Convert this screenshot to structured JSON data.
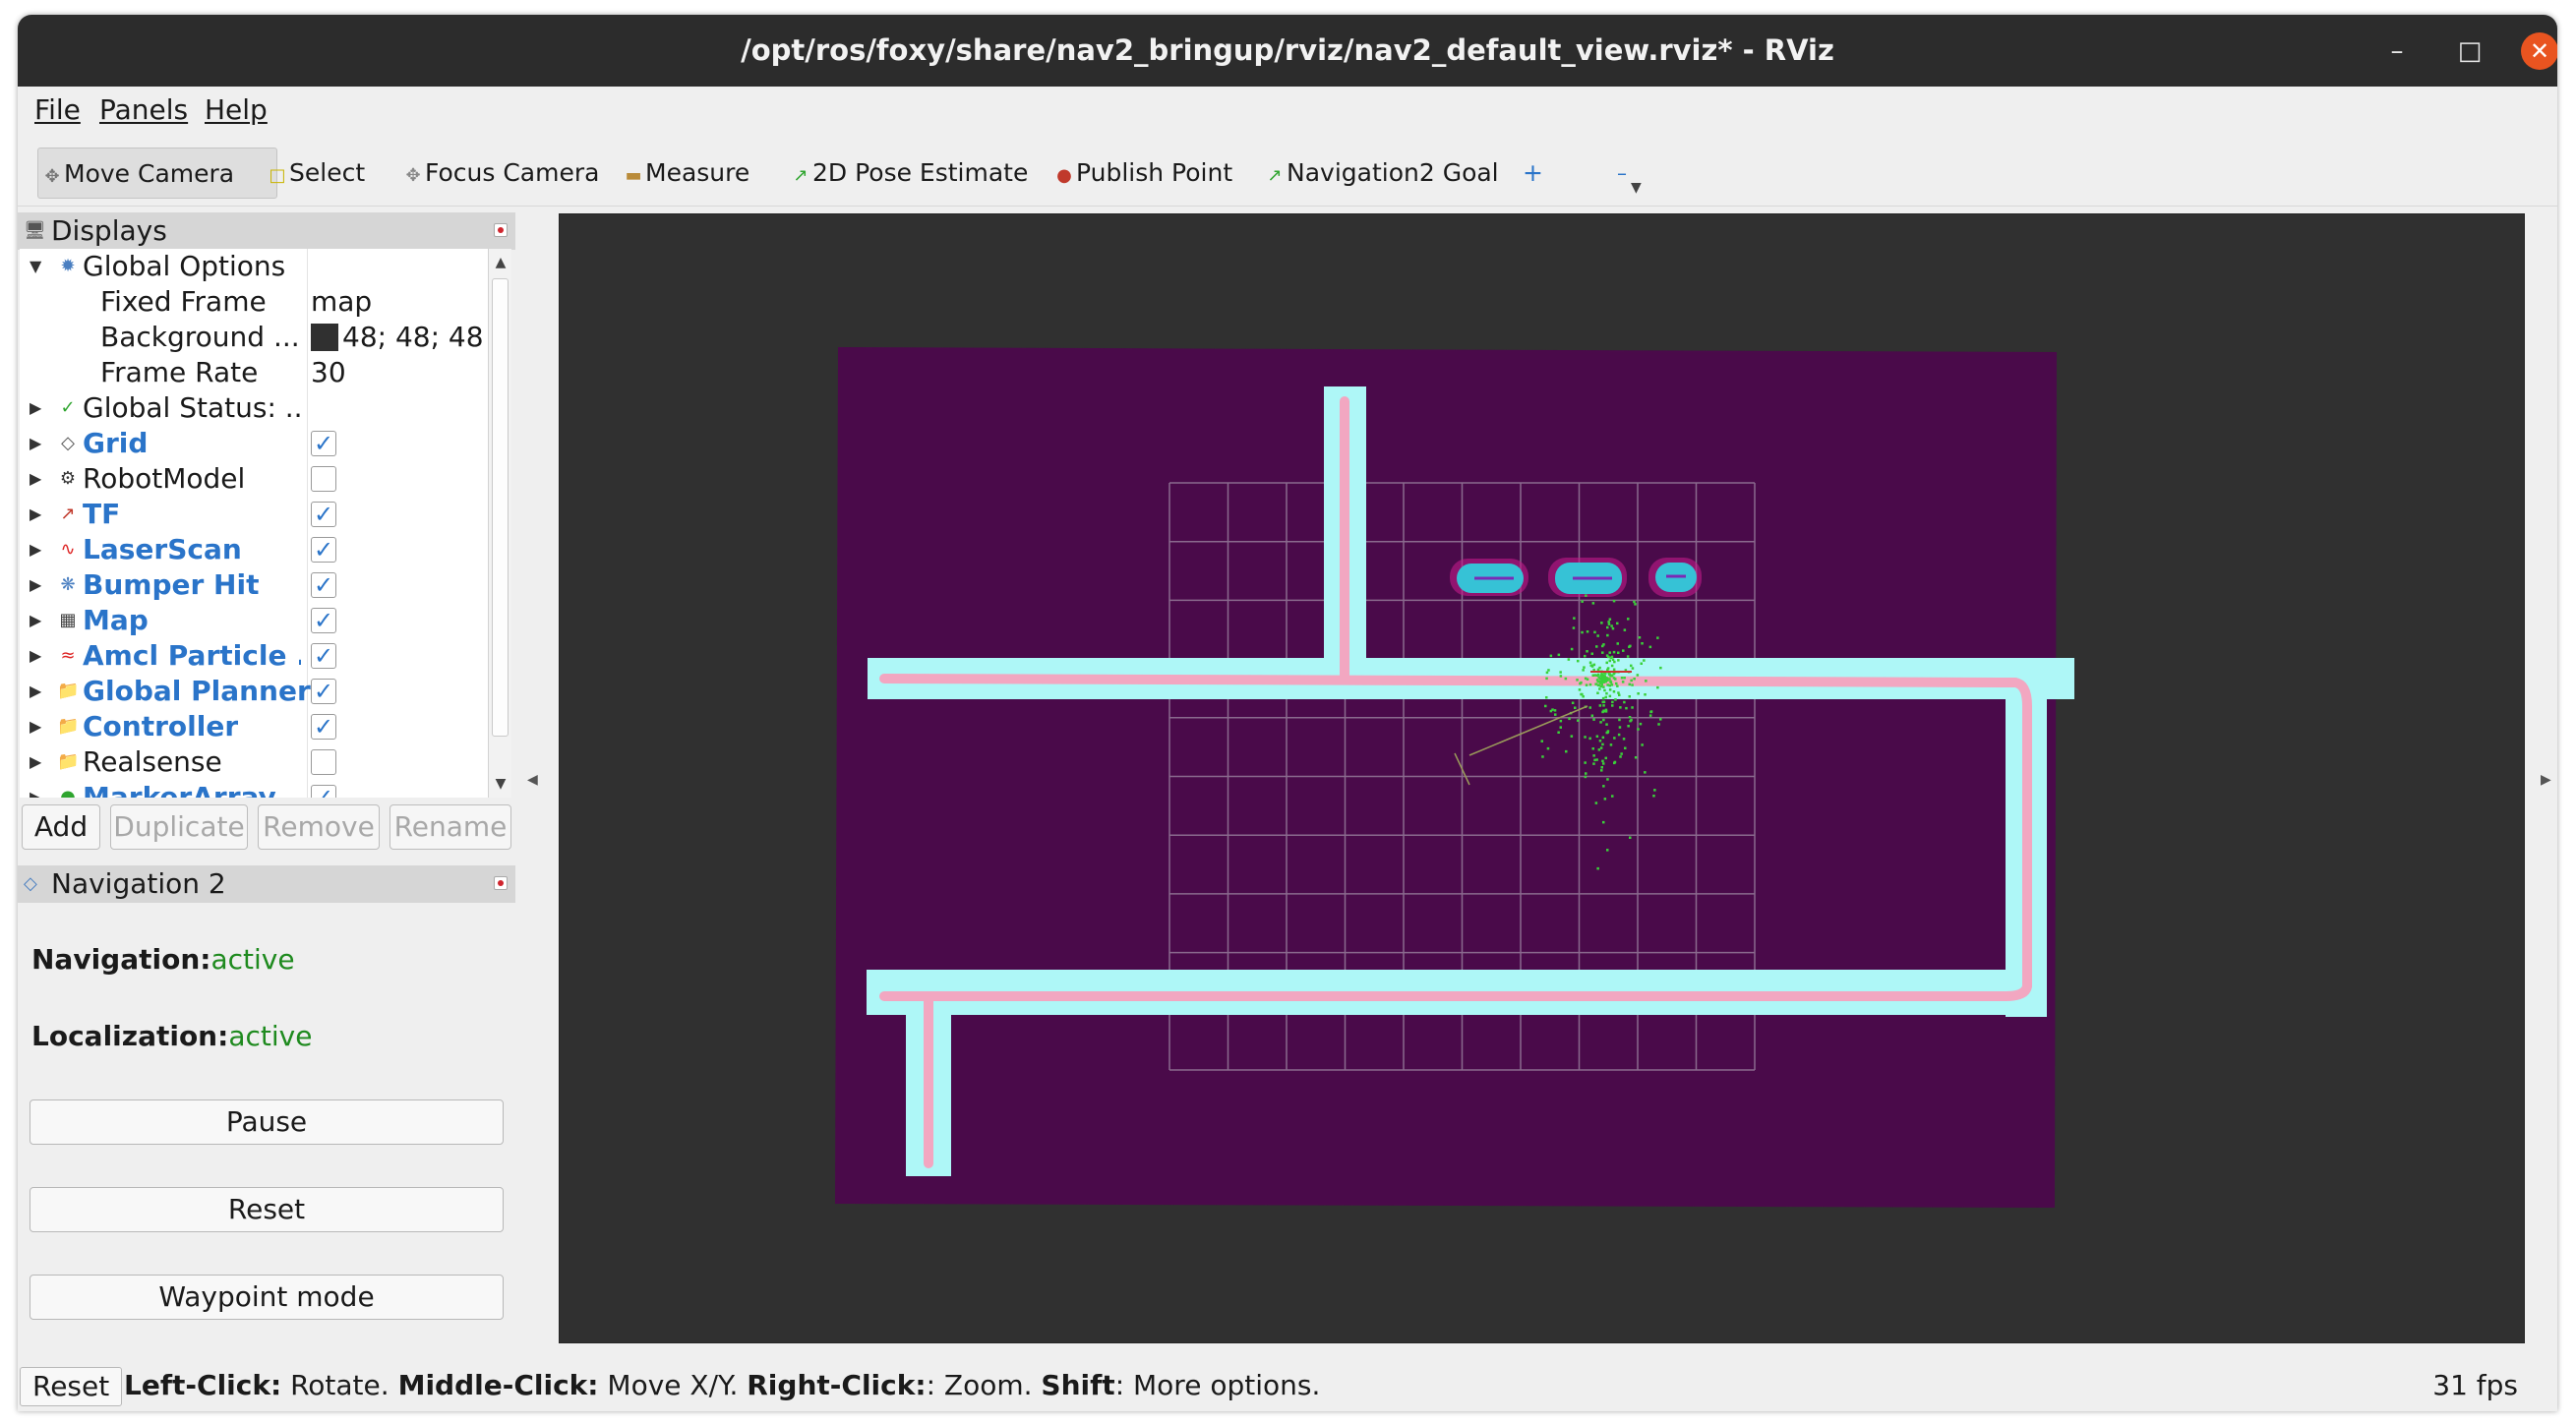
{
  "window": {
    "title": "/opt/ros/foxy/share/nav2_bringup/rviz/nav2_default_view.rviz* - RViz"
  },
  "menu": [
    "File",
    "Panels",
    "Help"
  ],
  "toolbar": [
    {
      "label": "Move Camera",
      "icon": "move-camera-icon"
    },
    {
      "label": "Select",
      "icon": "select-icon"
    },
    {
      "label": "Focus Camera",
      "icon": "focus-camera-icon"
    },
    {
      "label": "Measure",
      "icon": "measure-icon"
    },
    {
      "label": "2D Pose Estimate",
      "icon": "pose-arrow-icon"
    },
    {
      "label": "Publish Point",
      "icon": "pin-icon"
    },
    {
      "label": "Navigation2 Goal",
      "icon": "goal-arrow-icon"
    }
  ],
  "displays": {
    "title": "Displays",
    "global_options": "Global Options",
    "fixed_frame_label": "Fixed Frame",
    "fixed_frame_value": "map",
    "background_label": "Background ...",
    "background_value": "48; 48; 48",
    "background_color": "#303030",
    "frame_rate_label": "Frame Rate",
    "frame_rate_value": "30",
    "global_status": "Global Status: ...",
    "items": [
      {
        "name": "Grid",
        "checked": true
      },
      {
        "name": "RobotModel",
        "checked": false
      },
      {
        "name": "TF",
        "checked": true
      },
      {
        "name": "LaserScan",
        "checked": true
      },
      {
        "name": "Bumper Hit",
        "checked": true
      },
      {
        "name": "Map",
        "checked": true
      },
      {
        "name": "Amcl Particle ...",
        "checked": true
      },
      {
        "name": "Global Planner",
        "checked": true
      },
      {
        "name": "Controller",
        "checked": true
      },
      {
        "name": "Realsense",
        "checked": false
      },
      {
        "name": "MarkerArray",
        "checked": true
      }
    ],
    "buttons": {
      "add": "Add",
      "duplicate": "Duplicate",
      "remove": "Remove",
      "rename": "Rename"
    }
  },
  "navigation": {
    "title": "Navigation 2",
    "nav_label": "Navigation:",
    "nav_value": "active",
    "loc_label": "Localization:",
    "loc_value": "active",
    "pause": "Pause",
    "reset": "Reset",
    "waypoint": "Waypoint mode"
  },
  "status": {
    "reset": "Reset",
    "left_click": "Left-Click:",
    "left_action": "Rotate.",
    "middle_click": "Middle-Click:",
    "middle_action": "Move X/Y.",
    "right_click": "Right-Click:",
    "right_action": ": Zoom.",
    "shift": "Shift",
    "shift_action": ": More options.",
    "fps": "31 fps"
  },
  "colors": {
    "map_unknown": "#4a0a4a",
    "inflation": "#aef7f7",
    "path": "#f2a7c1",
    "obstacle": "#36c2d6",
    "accent": "#e95420",
    "active_green": "#1e8a1e"
  }
}
